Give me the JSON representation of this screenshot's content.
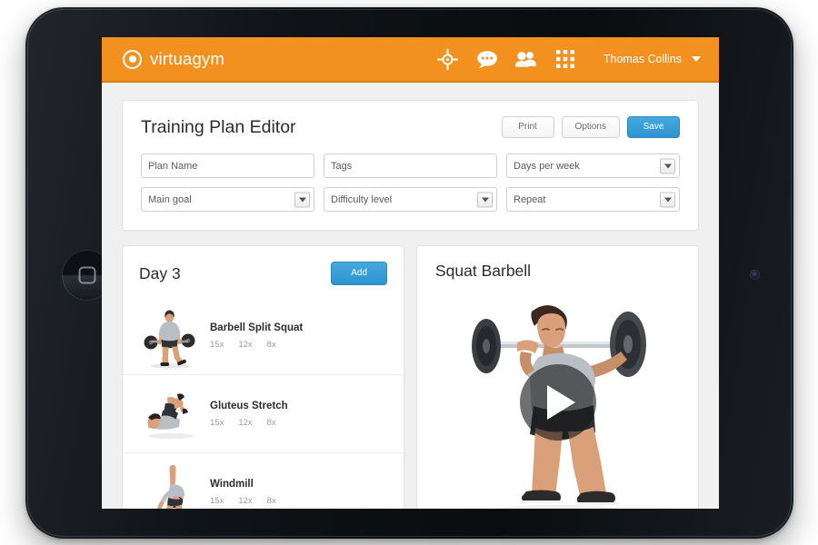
{
  "header": {
    "brand_name": "virtuagym",
    "logo_icon": "target-circle-icon",
    "nav_icons": [
      {
        "name": "crosshair-target-icon",
        "label": "Goals"
      },
      {
        "name": "chat-bubble-icon",
        "label": "Messages"
      },
      {
        "name": "people-icon",
        "label": "Community"
      },
      {
        "name": "grid-apps-icon",
        "label": "Apps"
      }
    ],
    "user_name": "Thomas Collins",
    "caret_icon": "chevron-down-icon",
    "background_color": "#f2911f"
  },
  "editor": {
    "title": "Training Plan Editor",
    "buttons": {
      "print": "Print",
      "options": "Options",
      "save": "Save"
    },
    "save_color": "#2e95d0",
    "fields": [
      {
        "label": "Plan Name",
        "type": "text",
        "value": "",
        "placeholder": "Plan Name"
      },
      {
        "label": "Tags",
        "type": "text",
        "value": "",
        "placeholder": "Tags"
      },
      {
        "label": "Days per week",
        "type": "select",
        "value": "Days per week"
      },
      {
        "label": "Main goal",
        "type": "select",
        "value": "Main goal"
      },
      {
        "label": "Difficulty level",
        "type": "select",
        "value": "Difficulty level"
      },
      {
        "label": "Repeat",
        "type": "select",
        "value": "Repeat"
      }
    ]
  },
  "day_panel": {
    "title": "Day 3",
    "add_label": "Add",
    "exercises": [
      {
        "name": "Barbell Split Squat",
        "thumb": "barbell-split-squat-thumb",
        "reps": [
          "15x",
          "12x",
          "8x"
        ]
      },
      {
        "name": "Gluteus Stretch",
        "thumb": "gluteus-stretch-thumb",
        "reps": [
          "15x",
          "12x",
          "8x"
        ]
      },
      {
        "name": "Windmill",
        "thumb": "windmill-thumb",
        "reps": [
          "15x",
          "12x",
          "8x"
        ]
      }
    ]
  },
  "video_panel": {
    "title": "Squat Barbell",
    "play_icon": "play-triangle-icon",
    "figure": "squat-barbell-athlete"
  },
  "device": {
    "home_button_icon": "home-square-icon",
    "camera_icon": "camera-dot-icon"
  }
}
